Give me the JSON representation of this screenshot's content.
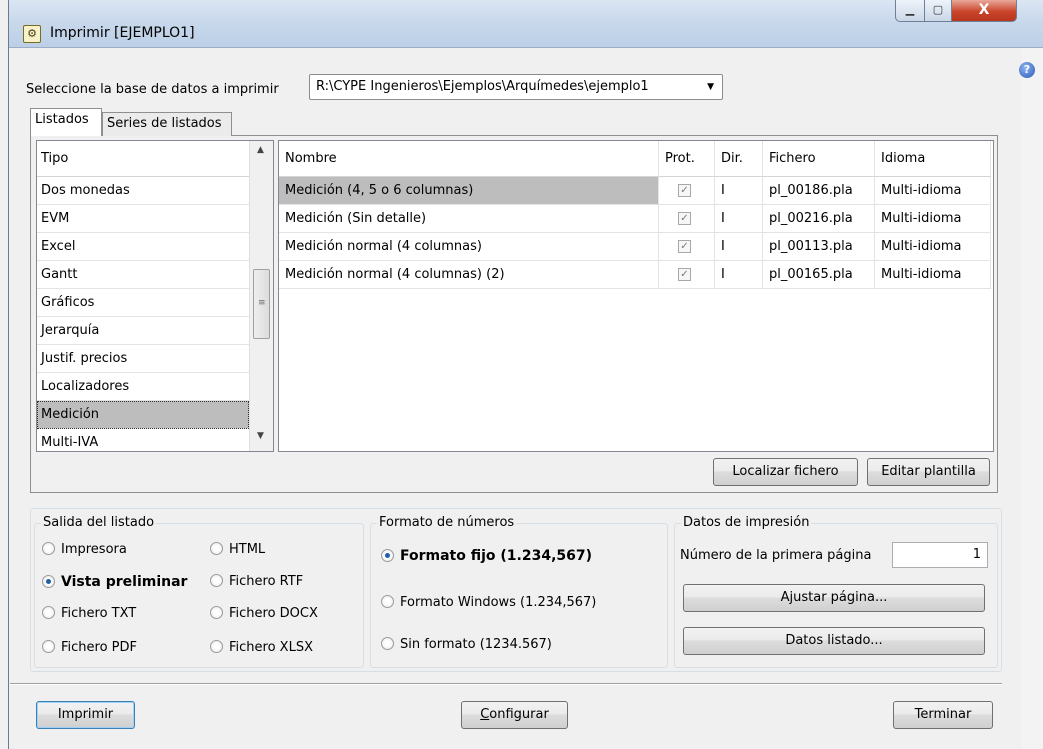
{
  "window": {
    "title": "Imprimir [EJEMPLO1]",
    "close_glyph": "X",
    "help_glyph": "?"
  },
  "database": {
    "label": "Seleccione la base de datos a imprimir",
    "selected": "R:\\CYPE Ingenieros\\Ejemplos\\Arquímedes\\ejemplo1"
  },
  "tabs": [
    {
      "label": "Listados",
      "active": true
    },
    {
      "label": "Series de listados",
      "active": false
    }
  ],
  "tipo_list": {
    "header": "Tipo",
    "items": [
      {
        "label": "Dos monedas",
        "selected": false
      },
      {
        "label": "EVM",
        "selected": false
      },
      {
        "label": "Excel",
        "selected": false
      },
      {
        "label": "Gantt",
        "selected": false
      },
      {
        "label": "Gráficos",
        "selected": false
      },
      {
        "label": "Jerarquía",
        "selected": false
      },
      {
        "label": "Justif. precios",
        "selected": false
      },
      {
        "label": "Localizadores",
        "selected": false
      },
      {
        "label": "Medición",
        "selected": true
      },
      {
        "label": "Multi-IVA",
        "selected": false
      }
    ]
  },
  "listados_table": {
    "columns": {
      "nombre": "Nombre",
      "prot": "Prot.",
      "dir": "Dir.",
      "fichero": "Fichero",
      "idioma": "Idioma"
    },
    "rows": [
      {
        "nombre": "Medición (4, 5 o 6 columnas)",
        "prot": true,
        "dir": "I",
        "fichero": "pl_00186.pla",
        "idioma": "Multi-idioma",
        "selected": true
      },
      {
        "nombre": "Medición (Sin detalle)",
        "prot": true,
        "dir": "I",
        "fichero": "pl_00216.pla",
        "idioma": "Multi-idioma",
        "selected": false
      },
      {
        "nombre": "Medición normal (4 columnas)",
        "prot": true,
        "dir": "I",
        "fichero": "pl_00113.pla",
        "idioma": "Multi-idioma",
        "selected": false
      },
      {
        "nombre": "Medición normal (4 columnas) (2)",
        "prot": true,
        "dir": "I",
        "fichero": "pl_00165.pla",
        "idioma": "Multi-idioma",
        "selected": false
      }
    ]
  },
  "table_buttons": {
    "localizar": "Localizar fichero",
    "editar": "Editar plantilla"
  },
  "salida": {
    "title": "Salida del listado",
    "options": {
      "impresora": "Impresora",
      "html": "HTML",
      "vista": "Vista preliminar",
      "rtf": "Fichero RTF",
      "txt": "Fichero TXT",
      "docx": "Fichero DOCX",
      "pdf": "Fichero PDF",
      "xlsx": "Fichero XLSX"
    },
    "selected": "vista"
  },
  "formato": {
    "title": "Formato de números",
    "options": {
      "fijo": "Formato fijo (1.234,567)",
      "windows": "Formato Windows (1.234,567)",
      "sin": "Sin formato (1234.567)"
    },
    "selected": "fijo"
  },
  "impresion": {
    "title": "Datos de impresión",
    "first_page_label": "Número de la primera página",
    "first_page_value": "1",
    "ajustar": "Ajustar página...",
    "datos": "Datos listado..."
  },
  "footer": {
    "imprimir": "Imprimir",
    "configurar_underlined": "C",
    "configurar_rest": "onfigurar",
    "terminar": "Terminar"
  },
  "colors": {
    "selection": "#bdbdbd",
    "close_button": "#c9452b",
    "default_button_border": "#3c7fb1"
  }
}
